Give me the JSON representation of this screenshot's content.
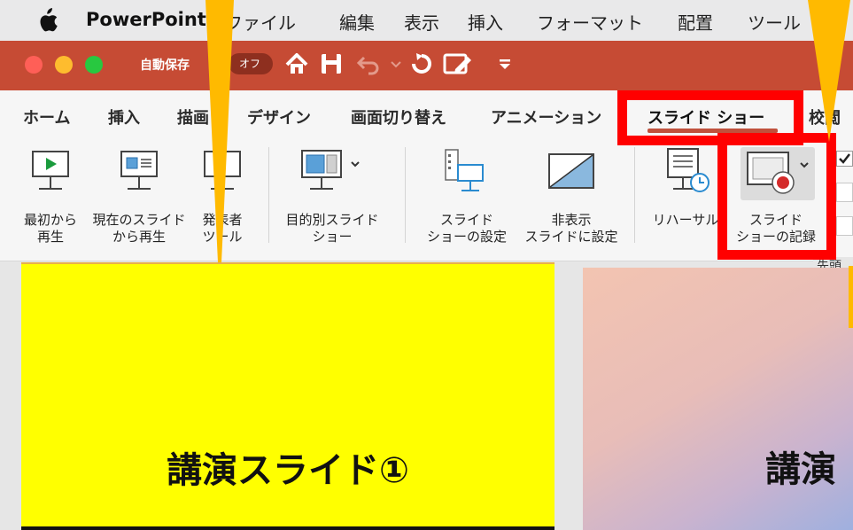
{
  "menubar": {
    "app_name": "PowerPoint",
    "items": [
      "ファイル",
      "編集",
      "表示",
      "挿入",
      "フォーマット",
      "配置",
      "ツール"
    ]
  },
  "titlebar": {
    "autosave_label": "自動保存",
    "autosave_state": "オフ"
  },
  "tabs": [
    "ホーム",
    "挿入",
    "描画",
    "デザイン",
    "画面切り替え",
    "アニメーション",
    "スライド ショー",
    "校閲"
  ],
  "active_tab": "スライド ショー",
  "ribbon": {
    "from_start": [
      "最初から",
      "再生"
    ],
    "from_current": [
      "現在のスライド",
      "から再生"
    ],
    "presenter": [
      "発表者",
      "ツール"
    ],
    "custom_show": [
      "目的別スライド",
      "ショー"
    ],
    "setup_show": [
      "スライド",
      "ショーの設定"
    ],
    "hide_slide": [
      "非表示",
      "スライドに設定"
    ],
    "rehearse": [
      "リハーサル"
    ],
    "record_show": [
      "スライド",
      "ショーの記録"
    ],
    "right_edge": "先頭"
  },
  "slides": {
    "slide1_title": "講演スライド①",
    "slide2_title": "講演"
  },
  "colors": {
    "titlebar": "#c64b34",
    "highlight": "#ff0000",
    "arrow": "#ffba00",
    "slide1_bg": "#ffff00"
  }
}
